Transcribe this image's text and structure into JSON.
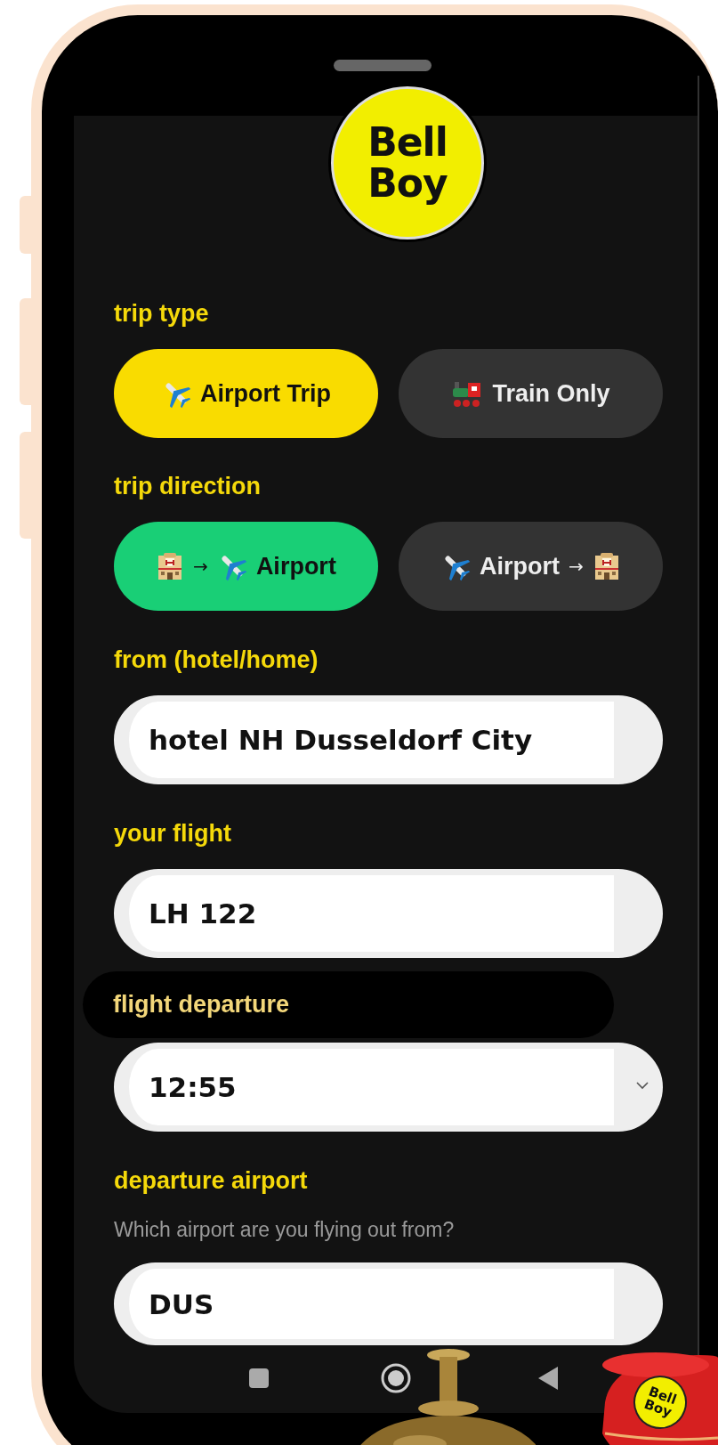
{
  "logo": {
    "lines": [
      "Bell",
      "Boy"
    ]
  },
  "trip_type": {
    "label": "trip type",
    "options": [
      {
        "kind": "airport",
        "label": "Airport Trip",
        "selected": true
      },
      {
        "kind": "train",
        "label": "Train Only",
        "selected": false
      }
    ]
  },
  "trip_direction": {
    "label": "trip direction",
    "options": [
      {
        "kind": "to_airport",
        "arrow": "→",
        "label": "Airport",
        "selected": true
      },
      {
        "kind": "from_airport",
        "arrow": "→",
        "label": "Airport",
        "selected": false
      }
    ]
  },
  "fields": [
    {
      "kind": "text",
      "label": "from (hotel/home)",
      "value": "hotel NH Dusseldorf City"
    },
    {
      "kind": "text",
      "label": "your flight",
      "value": "LH 122"
    },
    {
      "kind": "select",
      "label": "flight departure",
      "value": "12:55"
    },
    {
      "kind": "text",
      "label": "departure airport",
      "hint": "Which airport are you flying out from?",
      "value": "DUS"
    }
  ],
  "mascot": {
    "badge": [
      "Bell",
      "Boy"
    ]
  }
}
